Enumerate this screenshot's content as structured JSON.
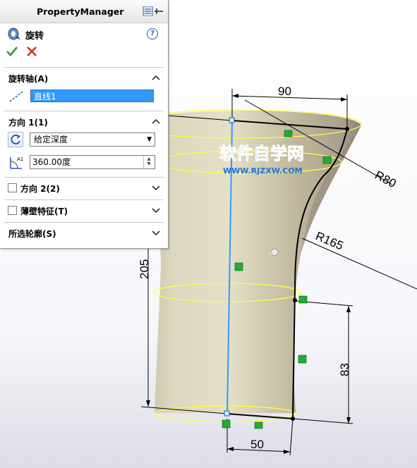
{
  "property_manager": {
    "title": "PropertyManager",
    "feature_name": "旋转",
    "help_glyph": "?",
    "ok_glyph": "✓",
    "cancel_glyph": "✕",
    "sections": {
      "axis": {
        "title": "旋转轴(A)",
        "value": "直线1"
      },
      "direction1": {
        "title": "方向 1(1)",
        "end_condition": "给定深度",
        "angle": "360.00度"
      },
      "direction2": {
        "title": "方向 2(2)",
        "checked": false
      },
      "thin_feature": {
        "title": "薄壁特征(T)",
        "checked": false
      },
      "selected_contours": {
        "title": "所选轮廓(S)"
      }
    }
  },
  "sketch": {
    "dimensions": {
      "top_width": "90",
      "fillet_top": "R80",
      "fillet_bottom": "R165",
      "height": "205",
      "lower_height": "83",
      "bottom_width": "50"
    }
  },
  "watermark": {
    "text": "软件自学网",
    "url": "WWW.RJZXW.COM"
  },
  "colors": {
    "axis_selection": "#3399ff",
    "body_fill": "#c7c1a3",
    "edge_highlight": "#ffff3a",
    "relation_green": "#22aa33",
    "watermark_blue": "#1a73d9"
  },
  "icons": [
    "revolve-icon",
    "help-icon",
    "ok-checkmark-icon",
    "cancel-x-icon",
    "chevron-up-icon",
    "chevron-down-icon",
    "line-icon",
    "reverse-direction-icon",
    "angle-icon",
    "pin-icon",
    "origin-icon"
  ]
}
